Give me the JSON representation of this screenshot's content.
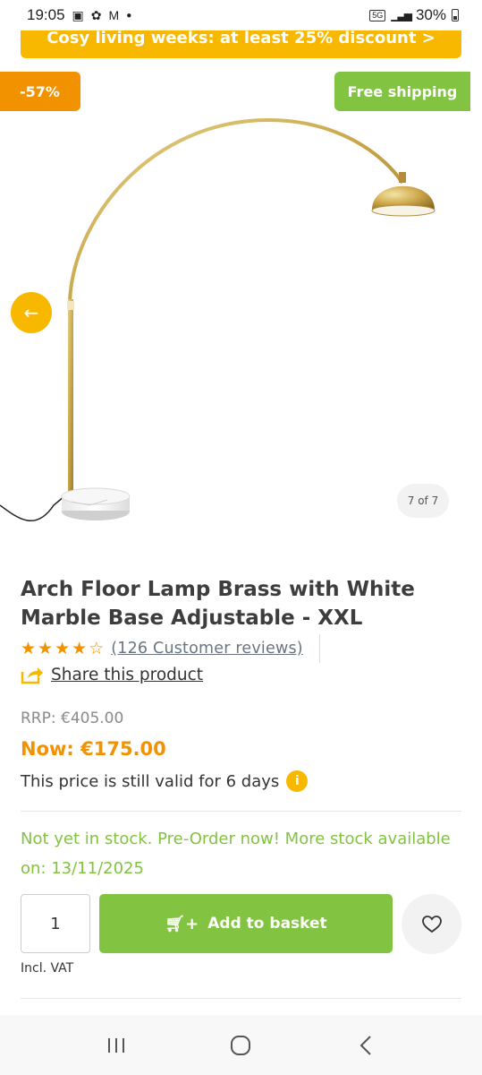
{
  "status_bar": {
    "time": "19:05",
    "network": "5G",
    "battery": "30%",
    "icons": [
      "gallery-icon",
      "settings-icon",
      "mail-icon",
      "dot-icon",
      "signal-icon",
      "battery-icon"
    ]
  },
  "promo": {
    "text": "Cosy living weeks: at least 25% discount >"
  },
  "badges": {
    "discount": "-57%",
    "shipping": "Free shipping"
  },
  "gallery": {
    "counter": "7 of 7",
    "prev_icon": "arrow-left-icon"
  },
  "product": {
    "title": "Arch Floor Lamp Brass with White Marble Base Adjustable - XXL",
    "rating": 4.5,
    "reviews": "(126 Customer reviews)",
    "share": "Share this product",
    "rrp": "RRP: €405.00",
    "now": "Now: €175.00",
    "valid": "This price is still valid for 6 days",
    "stock": "Not yet in stock. Pre-Order now! More stock available on: 13/11/2025"
  },
  "purchase": {
    "quantity": "1",
    "add_label": "Add to basket",
    "vat": "Incl. VAT"
  },
  "colors": {
    "accent_orange": "#f39200",
    "accent_yellow": "#f9b800",
    "accent_green": "#82c341"
  }
}
